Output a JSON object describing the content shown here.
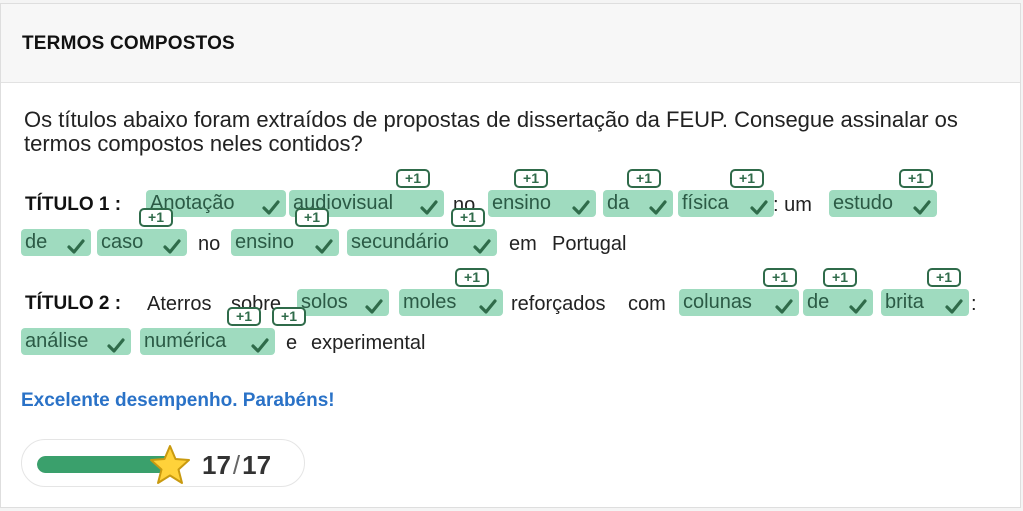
{
  "header": {
    "title": "TERMOS COMPOSTOS"
  },
  "instructions": "Os títulos abaixo foram extraídos de propostas de dissertação da FEUP. Consegue assinalar os termos compostos neles contidos?",
  "titles": [
    {
      "label": "TÍTULO 1 :",
      "lines": [
        [
          {
            "t": "tok",
            "text": "Anotação",
            "badge": ""
          },
          {
            "t": "tok",
            "text": "audiovisual",
            "badge": "+1"
          },
          {
            "t": "w",
            "text": "no"
          },
          {
            "t": "tok",
            "text": "ensino",
            "badge": "+1"
          },
          {
            "t": "tok",
            "text": "da",
            "badge": "+1"
          },
          {
            "t": "tok",
            "text": "física",
            "badge": "+1"
          },
          {
            "t": "w",
            "text": ": um"
          },
          {
            "t": "tok",
            "text": "estudo",
            "badge": "+1"
          }
        ],
        [
          {
            "t": "tok",
            "text": "de",
            "badge": ""
          },
          {
            "t": "tok",
            "text": "caso",
            "badge": "+1"
          },
          {
            "t": "w",
            "text": "no"
          },
          {
            "t": "tok",
            "text": "ensino",
            "badge": "+1"
          },
          {
            "t": "tok",
            "text": "secundário",
            "badge": "+1"
          },
          {
            "t": "w",
            "text": "em"
          },
          {
            "t": "w",
            "text": "Portugal"
          }
        ]
      ]
    },
    {
      "label": "TÍTULO 2 :",
      "lines": [
        [
          {
            "t": "w",
            "text": "Aterros"
          },
          {
            "t": "w",
            "text": "sobre"
          },
          {
            "t": "tok",
            "text": "solos",
            "badge": ""
          },
          {
            "t": "tok",
            "text": "moles",
            "badge": "+1"
          },
          {
            "t": "w",
            "text": "reforçados"
          },
          {
            "t": "w",
            "text": "com"
          },
          {
            "t": "tok",
            "text": "colunas",
            "badge": "+1"
          },
          {
            "t": "tok",
            "text": "de",
            "badge": "+1"
          },
          {
            "t": "tok",
            "text": "brita",
            "badge": "+1"
          },
          {
            "t": "w",
            "text": ":"
          }
        ],
        [
          {
            "t": "tok",
            "text": "análise",
            "badge": ""
          },
          {
            "t": "tok",
            "text": "numérica",
            "badge": "+1"
          },
          {
            "t": "w",
            "text": "e",
            "badge": "+1"
          },
          {
            "t": "w",
            "text": "experimental"
          }
        ]
      ]
    }
  ],
  "feedback": "Excelente desempenho. Parabéns!",
  "score": {
    "value": "17",
    "separator": "/",
    "total": "17",
    "progress": 1.0
  },
  "colors": {
    "token_bg": "#9fdbbf",
    "badge_border": "#2f6b4a",
    "feedback": "#2a72c7",
    "bar": "#3aa06c"
  },
  "icons": {
    "check": "check-icon",
    "star": "star-icon"
  }
}
